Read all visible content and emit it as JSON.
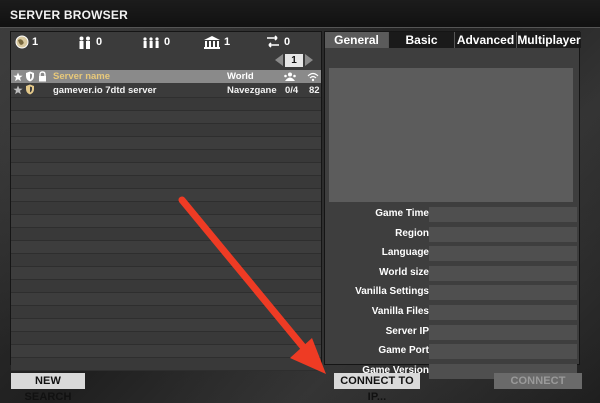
{
  "window": {
    "title": "SERVER BROWSER"
  },
  "filters": [
    {
      "icon": "globe-icon",
      "count": "1"
    },
    {
      "icon": "two-players-icon",
      "count": "0"
    },
    {
      "icon": "group-players-icon",
      "count": "0"
    },
    {
      "icon": "building-icon",
      "count": "1"
    },
    {
      "icon": "connection-icon",
      "count": "0"
    }
  ],
  "pager": {
    "page": "1"
  },
  "table": {
    "headers": {
      "name": "Server name",
      "world": "World"
    },
    "rows": [
      {
        "name": "gamever.io 7dtd server",
        "world": "Navezgane",
        "players": "0/4",
        "ping": "82"
      }
    ]
  },
  "tabs": [
    "General",
    "Basic",
    "Advanced",
    "Multiplayer"
  ],
  "info": {
    "labels": [
      "Game Time",
      "Region",
      "Language",
      "World size",
      "Vanilla Settings",
      "Vanilla Files",
      "Server IP",
      "Game Port",
      "Game Version"
    ]
  },
  "buttons": {
    "new_search": "NEW SEARCH",
    "connect_ip": "CONNECT TO IP...",
    "connect": "CONNECT"
  },
  "colors": {
    "annotation_arrow": "#ee3b24",
    "header_name": "#e8c97a",
    "selected_row": "#8a8a8a"
  }
}
